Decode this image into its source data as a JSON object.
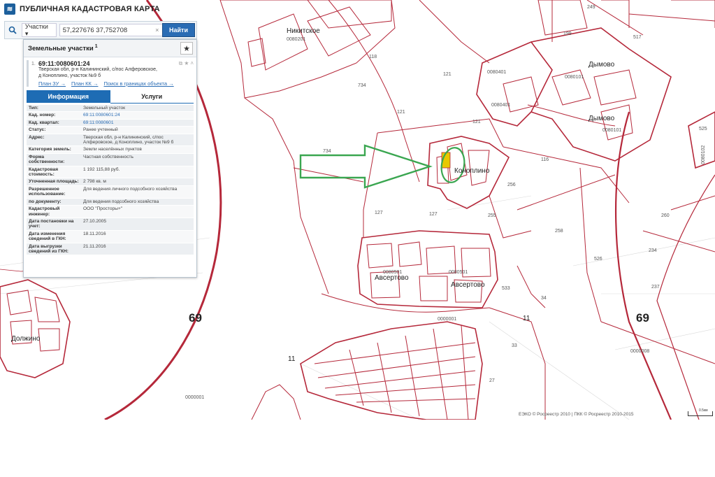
{
  "header": {
    "title": "ПУБЛИЧНАЯ КАДАСТРОВАЯ КАРТА",
    "logo": "≋"
  },
  "search": {
    "type_label": "Участки ▾",
    "value": "57,227676 37,752708",
    "clear": "×",
    "button": "Найти"
  },
  "panel": {
    "title": "Земельные участки",
    "count": "1",
    "star": "★",
    "card": {
      "index": "1.",
      "number": "69:11:0080601:24",
      "address": [
        "Тверская обл, р-н Калининский, с/пос Алферовское,",
        "д Коноплино, участок №9 б"
      ],
      "icons": "⧉ ★ ˄",
      "links": [
        "План ЗУ →",
        "План КК →",
        "Поиск в границах объекта →"
      ]
    },
    "tabs": {
      "info": "Информация",
      "services": "Услуги"
    },
    "properties": [
      {
        "key": "Тип:",
        "value": "Земельный участок"
      },
      {
        "key": "Кад. номер:",
        "value": "69:11:0080601:24",
        "link": true
      },
      {
        "key": "Кад. квартал:",
        "value": "69:11:0080601",
        "link": true
      },
      {
        "key": "Статус:",
        "value": "Ранее учтенный"
      },
      {
        "key": "Адрес:",
        "value": "Тверская обл, р-н Калининский, с/пос Алферовское, д Коноплино, участок №9 б"
      },
      {
        "key": "Категория земель:",
        "value": "Земли населённых пунктов"
      },
      {
        "key": "Форма собственности:",
        "value": "Частная собственность"
      },
      {
        "key": "Кадастровая стоимость:",
        "value": "1 192 115,88 руб."
      },
      {
        "key": "Уточненная площадь:",
        "value": "2 798 кв. м"
      },
      {
        "key": "Разрешенное использование:",
        "value": "Для ведения личного подсобного хозяйства"
      },
      {
        "key": "по документу:",
        "value": "Для ведения подсобного хозяйства"
      },
      {
        "key": "Кадастровый инженер:",
        "value": "ООО \"Просторы+\""
      },
      {
        "key": "Дата постановки на учет:",
        "value": "27.10.2005"
      },
      {
        "key": "Дата изменения сведений в ГКН:",
        "value": "18.11.2016"
      },
      {
        "key": "Дата выгрузки сведений из ГКН:",
        "value": "21.11.2016"
      }
    ]
  },
  "map": {
    "places": {
      "nikitskoe": "Никитское",
      "dymovo1": "Дымово",
      "dymovo2": "Дымово",
      "konoplino": "Коноплино",
      "avsertovo1": "Авсертово",
      "avsertovo2": "Авсертово",
      "dolzhino": "Должино"
    },
    "codes": {
      "c1": "0080201",
      "c2": "0080401",
      "c3": "0080101",
      "c4": "0080401",
      "c5": "0080101",
      "c6": "0080501",
      "c7": "0080501",
      "c8": "0000001",
      "c9": "0000008",
      "c10": "0000001",
      "c11": "0080102"
    },
    "regions": {
      "r1": "69",
      "r2": "69",
      "r3": "11",
      "r4": "11"
    },
    "parcels": {
      "p118": "118",
      "p734a": "734",
      "p734b": "734",
      "p121a": "121",
      "p121b": "121",
      "p121c": "121",
      "p199": "199",
      "p517": "517",
      "p116": "116",
      "p256": "256",
      "p255": "255",
      "p258": "258",
      "p127a": "127",
      "p127b": "127",
      "p260": "260",
      "p234": "234",
      "p237": "237",
      "p526": "526",
      "p525": "525",
      "p34": "34",
      "p33": "33",
      "p27": "27",
      "p249": "249",
      "p533": "533"
    },
    "credits": "ЕЭКО © Росреестр 2010 | ПКК © Росреестр 2010-2015",
    "scale": "0.5км",
    "colors": {
      "boundary": "#b5283a",
      "arrow": "#3aa650",
      "highlight": "#e8c800"
    }
  }
}
